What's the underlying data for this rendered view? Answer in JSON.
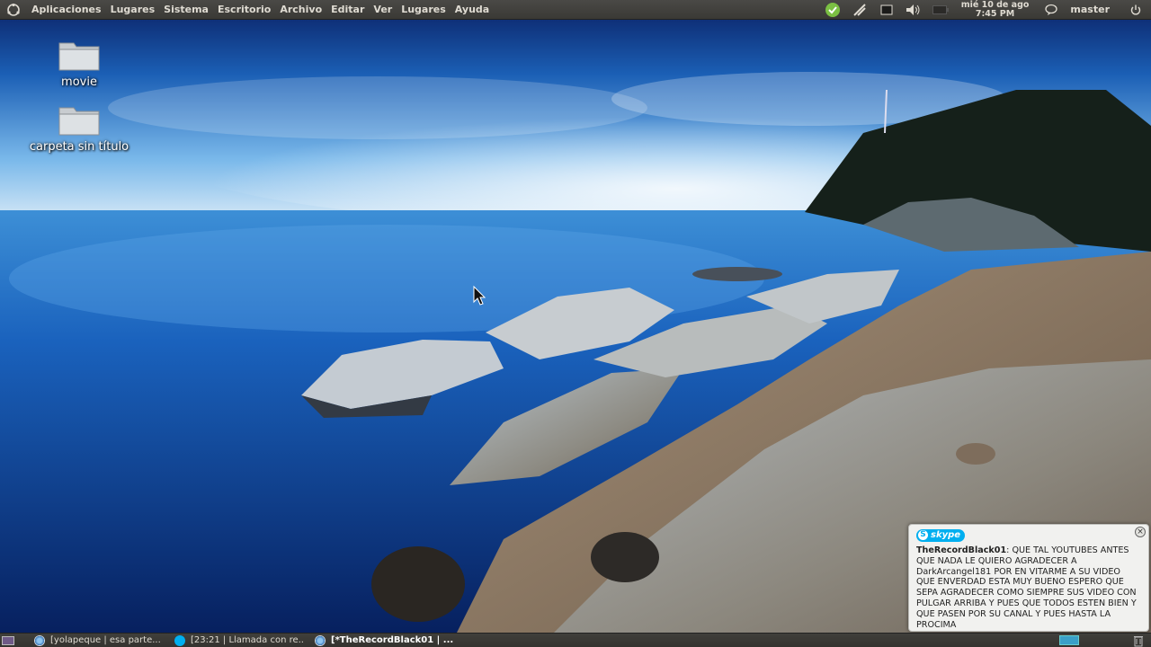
{
  "top_panel": {
    "menus": [
      "Aplicaciones",
      "Lugares",
      "Sistema",
      "Escritorio",
      "Archivo",
      "Editar",
      "Ver",
      "Lugares",
      "Ayuda"
    ],
    "clock": {
      "date": "mié 10 de ago",
      "time": "7:45 PM"
    },
    "user": "master",
    "tray_icons": [
      "skype-status-icon",
      "network-icon",
      "window-icon",
      "volume-icon",
      "battery-icon",
      "chat-icon",
      "power-icon"
    ]
  },
  "desktop": {
    "icons": [
      {
        "label": "movie",
        "icon": "folder-icon"
      },
      {
        "label": "carpeta sin título",
        "icon": "folder-icon"
      }
    ]
  },
  "notification": {
    "app": "skype",
    "sender": "TheRecordBlack01",
    "message": ": QUE TAL YOUTUBES ANTES QUE NADA LE QUIERO AGRADECER A DarkArcangel181 POR EN VITARME A SU VIDEO QUE ENVERDAD ESTA MUY BUENO ESPERO QUE SEPA AGRADECER COMO SIEMPRE SUS VIDEO CON PULGAR ARRIBA Y PUES QUE TODOS ESTEN BIEN Y QUE PASEN POR SU CANAL Y PUES HASTA LA PROCIMA"
  },
  "taskbar": {
    "tasks": [
      {
        "label": "[yolapeque | esa parte...",
        "icon": "chromium-icon"
      },
      {
        "label": "[23:21 | Llamada con re...",
        "icon": "skype-icon"
      },
      {
        "label": "[*TheRecordBlack01 | ...",
        "icon": "chromium-icon"
      }
    ]
  },
  "colors": {
    "panel": "#3c3b37",
    "skype_blue": "#00aff0",
    "sea": "#0b3f8c"
  }
}
